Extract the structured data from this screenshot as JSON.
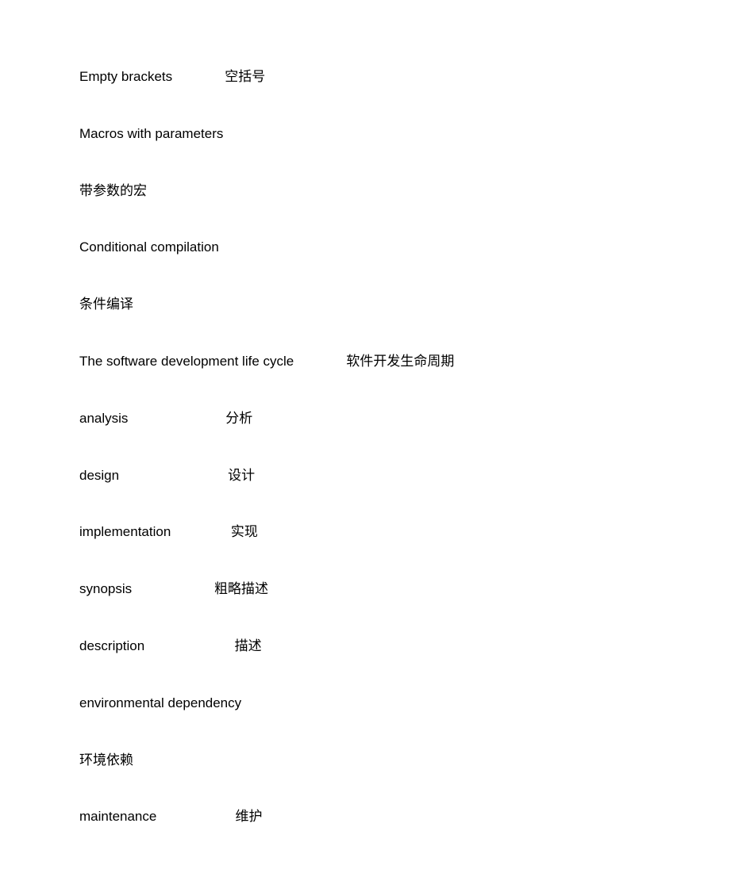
{
  "lines": [
    "Empty brackets              空括号",
    "Macros with parameters",
    "带参数的宏",
    "Conditional compilation",
    "条件编译",
    "The software development life cycle              软件开发生命周期",
    "analysis                          分析",
    "design                             设计",
    "implementation                实现",
    "synopsis                      粗略描述",
    "description                        描述",
    "environmental dependency",
    "环境依赖",
    "maintenance                     维护"
  ]
}
